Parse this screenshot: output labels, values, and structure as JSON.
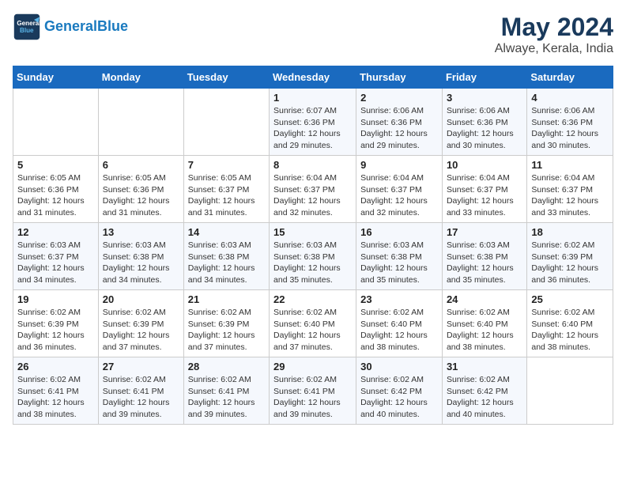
{
  "header": {
    "logo_line1": "General",
    "logo_line2": "Blue",
    "month": "May 2024",
    "location": "Alwaye, Kerala, India"
  },
  "weekdays": [
    "Sunday",
    "Monday",
    "Tuesday",
    "Wednesday",
    "Thursday",
    "Friday",
    "Saturday"
  ],
  "weeks": [
    [
      {
        "day": "",
        "detail": ""
      },
      {
        "day": "",
        "detail": ""
      },
      {
        "day": "",
        "detail": ""
      },
      {
        "day": "1",
        "detail": "Sunrise: 6:07 AM\nSunset: 6:36 PM\nDaylight: 12 hours\nand 29 minutes."
      },
      {
        "day": "2",
        "detail": "Sunrise: 6:06 AM\nSunset: 6:36 PM\nDaylight: 12 hours\nand 29 minutes."
      },
      {
        "day": "3",
        "detail": "Sunrise: 6:06 AM\nSunset: 6:36 PM\nDaylight: 12 hours\nand 30 minutes."
      },
      {
        "day": "4",
        "detail": "Sunrise: 6:06 AM\nSunset: 6:36 PM\nDaylight: 12 hours\nand 30 minutes."
      }
    ],
    [
      {
        "day": "5",
        "detail": "Sunrise: 6:05 AM\nSunset: 6:36 PM\nDaylight: 12 hours\nand 31 minutes."
      },
      {
        "day": "6",
        "detail": "Sunrise: 6:05 AM\nSunset: 6:36 PM\nDaylight: 12 hours\nand 31 minutes."
      },
      {
        "day": "7",
        "detail": "Sunrise: 6:05 AM\nSunset: 6:37 PM\nDaylight: 12 hours\nand 31 minutes."
      },
      {
        "day": "8",
        "detail": "Sunrise: 6:04 AM\nSunset: 6:37 PM\nDaylight: 12 hours\nand 32 minutes."
      },
      {
        "day": "9",
        "detail": "Sunrise: 6:04 AM\nSunset: 6:37 PM\nDaylight: 12 hours\nand 32 minutes."
      },
      {
        "day": "10",
        "detail": "Sunrise: 6:04 AM\nSunset: 6:37 PM\nDaylight: 12 hours\nand 33 minutes."
      },
      {
        "day": "11",
        "detail": "Sunrise: 6:04 AM\nSunset: 6:37 PM\nDaylight: 12 hours\nand 33 minutes."
      }
    ],
    [
      {
        "day": "12",
        "detail": "Sunrise: 6:03 AM\nSunset: 6:37 PM\nDaylight: 12 hours\nand 34 minutes."
      },
      {
        "day": "13",
        "detail": "Sunrise: 6:03 AM\nSunset: 6:38 PM\nDaylight: 12 hours\nand 34 minutes."
      },
      {
        "day": "14",
        "detail": "Sunrise: 6:03 AM\nSunset: 6:38 PM\nDaylight: 12 hours\nand 34 minutes."
      },
      {
        "day": "15",
        "detail": "Sunrise: 6:03 AM\nSunset: 6:38 PM\nDaylight: 12 hours\nand 35 minutes."
      },
      {
        "day": "16",
        "detail": "Sunrise: 6:03 AM\nSunset: 6:38 PM\nDaylight: 12 hours\nand 35 minutes."
      },
      {
        "day": "17",
        "detail": "Sunrise: 6:03 AM\nSunset: 6:38 PM\nDaylight: 12 hours\nand 35 minutes."
      },
      {
        "day": "18",
        "detail": "Sunrise: 6:02 AM\nSunset: 6:39 PM\nDaylight: 12 hours\nand 36 minutes."
      }
    ],
    [
      {
        "day": "19",
        "detail": "Sunrise: 6:02 AM\nSunset: 6:39 PM\nDaylight: 12 hours\nand 36 minutes."
      },
      {
        "day": "20",
        "detail": "Sunrise: 6:02 AM\nSunset: 6:39 PM\nDaylight: 12 hours\nand 37 minutes."
      },
      {
        "day": "21",
        "detail": "Sunrise: 6:02 AM\nSunset: 6:39 PM\nDaylight: 12 hours\nand 37 minutes."
      },
      {
        "day": "22",
        "detail": "Sunrise: 6:02 AM\nSunset: 6:40 PM\nDaylight: 12 hours\nand 37 minutes."
      },
      {
        "day": "23",
        "detail": "Sunrise: 6:02 AM\nSunset: 6:40 PM\nDaylight: 12 hours\nand 38 minutes."
      },
      {
        "day": "24",
        "detail": "Sunrise: 6:02 AM\nSunset: 6:40 PM\nDaylight: 12 hours\nand 38 minutes."
      },
      {
        "day": "25",
        "detail": "Sunrise: 6:02 AM\nSunset: 6:40 PM\nDaylight: 12 hours\nand 38 minutes."
      }
    ],
    [
      {
        "day": "26",
        "detail": "Sunrise: 6:02 AM\nSunset: 6:41 PM\nDaylight: 12 hours\nand 38 minutes."
      },
      {
        "day": "27",
        "detail": "Sunrise: 6:02 AM\nSunset: 6:41 PM\nDaylight: 12 hours\nand 39 minutes."
      },
      {
        "day": "28",
        "detail": "Sunrise: 6:02 AM\nSunset: 6:41 PM\nDaylight: 12 hours\nand 39 minutes."
      },
      {
        "day": "29",
        "detail": "Sunrise: 6:02 AM\nSunset: 6:41 PM\nDaylight: 12 hours\nand 39 minutes."
      },
      {
        "day": "30",
        "detail": "Sunrise: 6:02 AM\nSunset: 6:42 PM\nDaylight: 12 hours\nand 40 minutes."
      },
      {
        "day": "31",
        "detail": "Sunrise: 6:02 AM\nSunset: 6:42 PM\nDaylight: 12 hours\nand 40 minutes."
      },
      {
        "day": "",
        "detail": ""
      }
    ]
  ]
}
